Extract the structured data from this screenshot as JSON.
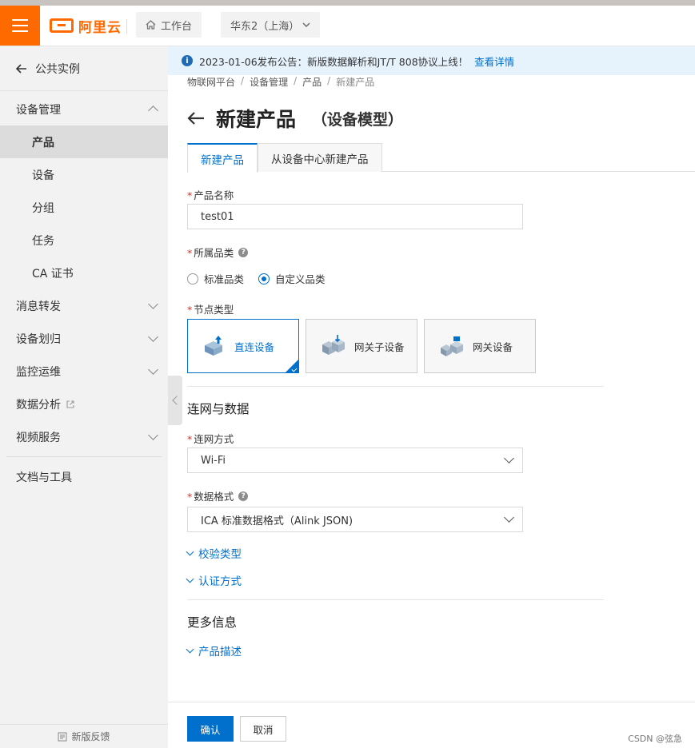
{
  "topbar": {
    "logo_text": "阿里云",
    "workbench_label": "工作台",
    "region_label": "华东2（上海）"
  },
  "sidebar": {
    "back_label": "公共实例",
    "groups": [
      {
        "label": "设备管理",
        "expanded": true
      },
      {
        "label": "消息转发"
      },
      {
        "label": "设备划归"
      },
      {
        "label": "监控运维"
      },
      {
        "label": "数据分析"
      },
      {
        "label": "视频服务"
      },
      {
        "label": "文档与工具"
      }
    ],
    "items": [
      {
        "label": "产品",
        "active": true
      },
      {
        "label": "设备"
      },
      {
        "label": "分组"
      },
      {
        "label": "任务"
      },
      {
        "label": "CA 证书"
      }
    ],
    "feedback_label": "新版反馈"
  },
  "notice": {
    "text": "2023-01-06发布公告：新版数据解析和JT/T 808协议上线！",
    "link": "查看详情"
  },
  "breadcrumb": [
    "物联网平台",
    "设备管理",
    "产品",
    "新建产品"
  ],
  "page": {
    "title": "新建产品",
    "subtitle": "（设备模型）"
  },
  "tabs": [
    "新建产品",
    "从设备中心新建产品"
  ],
  "form": {
    "product_name": {
      "label": "产品名称",
      "value": "test01"
    },
    "category": {
      "label": "所属品类",
      "options": [
        "标准品类",
        "自定义品类"
      ],
      "selected": "自定义品类"
    },
    "node_type": {
      "label": "节点类型",
      "options": [
        "直连设备",
        "网关子设备",
        "网关设备"
      ],
      "selected": "直连设备"
    },
    "network_section_title": "连网与数据",
    "network_method": {
      "label": "连网方式",
      "value": "Wi-Fi"
    },
    "data_format": {
      "label": "数据格式",
      "value": "ICA 标准数据格式（Alink JSON)"
    },
    "verify_type_link": "校验类型",
    "auth_method_link": "认证方式",
    "more_section_title": "更多信息",
    "product_desc_link": "产品描述"
  },
  "footer": {
    "confirm_label": "确认",
    "cancel_label": "取消",
    "watermark": "CSDN @弦急"
  },
  "colors": {
    "brand": "#ff6a00",
    "primary": "#0070cc",
    "notice_bg": "#e6f3fd",
    "sidebar_bg": "#f2f2f2",
    "required": "#d93026"
  }
}
